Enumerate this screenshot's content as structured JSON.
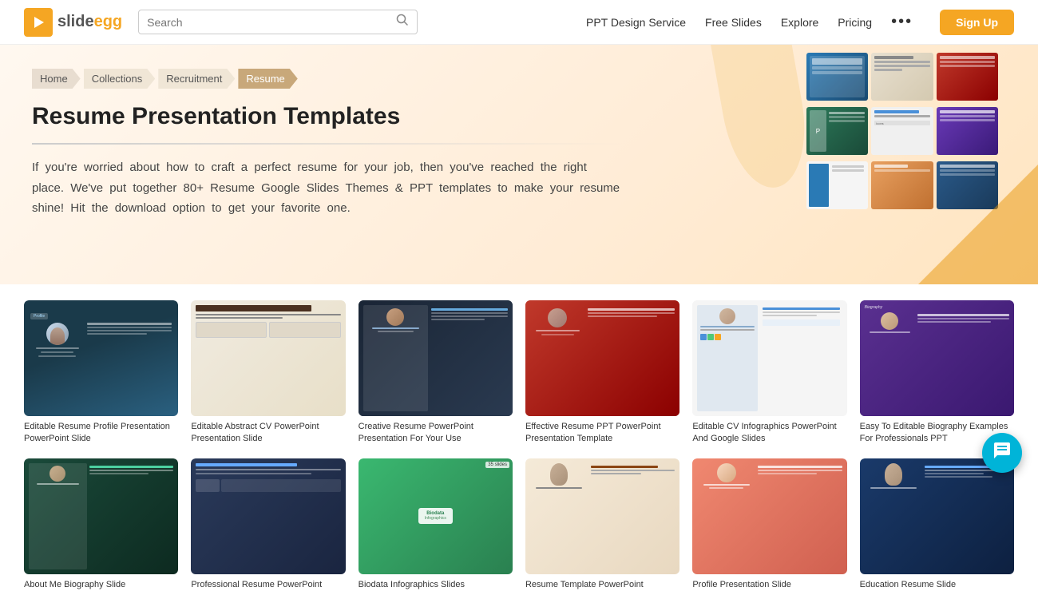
{
  "header": {
    "logo_symbol": "▶",
    "logo_text_part1": "slide",
    "logo_text_part2": "egg",
    "search_placeholder": "Search",
    "nav": {
      "ppt_design": "PPT Design Service",
      "free_slides": "Free Slides",
      "explore": "Explore",
      "pricing": "Pricing",
      "more_dots": "•••",
      "sign_up": "Sign Up"
    }
  },
  "breadcrumb": {
    "items": [
      {
        "label": "Home",
        "active": false
      },
      {
        "label": "Collections",
        "active": false
      },
      {
        "label": "Recruitment",
        "active": false
      },
      {
        "label": "Resume",
        "active": true
      }
    ]
  },
  "hero": {
    "title": "Resume Presentation Templates",
    "description": "If you're worried about how to craft a perfect resume for your job, then you've reached the right place. We've put together 80+ Resume Google Slides Themes & PPT templates to make your resume shine! Hit the download option to get your favorite one."
  },
  "templates": {
    "row1": [
      {
        "id": "tpl1",
        "title": "Editable Resume Profile Presentation PowerPoint Slide",
        "color_scheme": "dark-teal"
      },
      {
        "id": "tpl2",
        "title": "Editable Abstract CV PowerPoint Presentation Slide",
        "color_scheme": "beige"
      },
      {
        "id": "tpl3",
        "title": "Creative Resume PowerPoint Presentation For Your Use",
        "color_scheme": "dark-blue"
      },
      {
        "id": "tpl4",
        "title": "Effective Resume PPT PowerPoint Presentation Template",
        "color_scheme": "red"
      },
      {
        "id": "tpl5",
        "title": "Editable CV Infographics PowerPoint And Google Slides",
        "color_scheme": "light-gray"
      },
      {
        "id": "tpl6",
        "title": "Easy To Editable Biography Examples For Professionals PPT",
        "color_scheme": "purple"
      }
    ],
    "row2": [
      {
        "id": "tpl7",
        "title": "About Me Biography Slide",
        "color_scheme": "dark-green"
      },
      {
        "id": "tpl8",
        "title": "Professional Resume PowerPoint",
        "color_scheme": "dark-navy"
      },
      {
        "id": "tpl9",
        "title": "Biodata Infographics Slides",
        "color_scheme": "mint-green"
      },
      {
        "id": "tpl10",
        "title": "Resume Template PowerPoint",
        "color_scheme": "peach"
      },
      {
        "id": "tpl11",
        "title": "Profile Presentation Slide",
        "color_scheme": "salmon"
      },
      {
        "id": "tpl12",
        "title": "Education Resume Slide",
        "color_scheme": "navy-blue"
      }
    ]
  },
  "chat": {
    "icon": "💬"
  }
}
